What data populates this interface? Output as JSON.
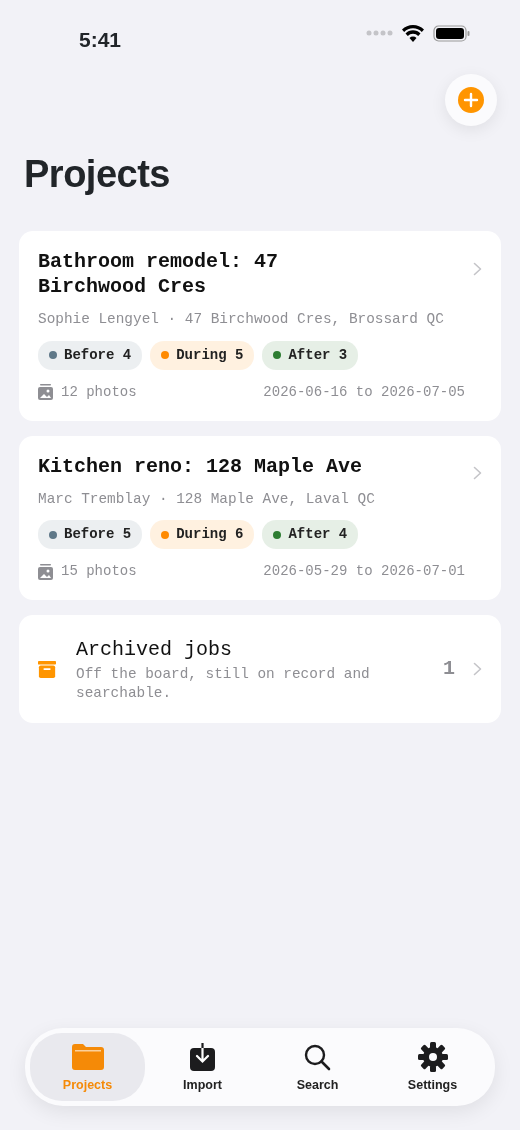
{
  "status_bar": {
    "time": "5:41"
  },
  "title": "Projects",
  "projects": [
    {
      "title": "Bathroom remodel: 47 Birchwood Cres",
      "subtitle": "Sophie Lengyel · 47 Birchwood Cres, Brossard QC",
      "tags": [
        {
          "label": "Before 4",
          "color": "#5f7888"
        },
        {
          "label": "During 5",
          "color": "#ff8a00"
        },
        {
          "label": "After 3",
          "color": "#2e7d32"
        }
      ],
      "photos": "12 photos",
      "dates": "2026-06-16 to 2026-07-05"
    },
    {
      "title": "Kitchen reno: 128 Maple Ave",
      "subtitle": "Marc Tremblay · 128 Maple Ave, Laval QC",
      "tags": [
        {
          "label": "Before 5",
          "color": "#5f7888"
        },
        {
          "label": "During 6",
          "color": "#ff8a00"
        },
        {
          "label": "After 4",
          "color": "#2e7d32"
        }
      ],
      "photos": "15 photos",
      "dates": "2026-05-29 to 2026-07-01"
    }
  ],
  "archive": {
    "title": "Archived jobs",
    "description": "Off the board, still on record and searchable.",
    "count": "1"
  },
  "tab_bar": [
    {
      "kind": "folder",
      "label": "Projects",
      "selected": true
    },
    {
      "kind": "import",
      "label": "Import",
      "selected": false
    },
    {
      "kind": "search",
      "label": "Search",
      "selected": false
    },
    {
      "kind": "gear",
      "label": "Settings",
      "selected": false
    }
  ]
}
